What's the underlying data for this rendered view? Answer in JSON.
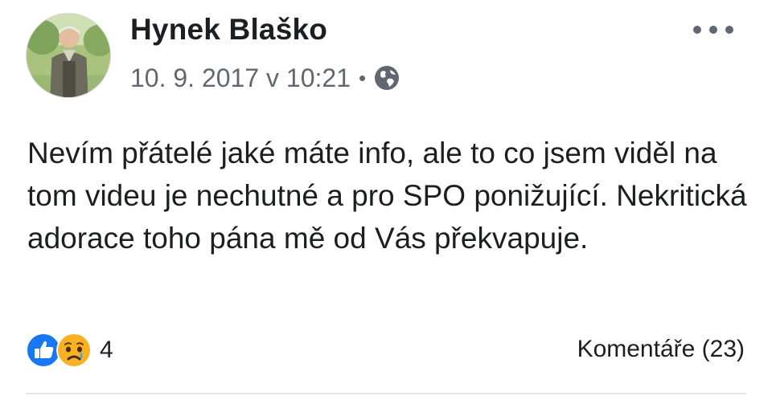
{
  "post": {
    "author": {
      "name": "Hynek Blaško",
      "avatar_icon": "person-photo"
    },
    "timestamp": "10. 9. 2017 v 10:21",
    "separator": "•",
    "audience_icon": "globe-icon",
    "more_icon": "more-options-icon",
    "text": "Nevím přátelé jaké máte info, ale to co jsem viděl na tom videu je nechutné a pro SPO ponižující. Nekritická adorace toho pána mě od Vás překvapuje.",
    "reactions": {
      "icons": [
        "like-icon",
        "sad-icon"
      ],
      "count": "4"
    },
    "comments_label": "Komentáře (23)"
  },
  "colors": {
    "like_blue": "#1877f2",
    "sad_yellow": "#f7b125",
    "meta_gray": "#606770",
    "text": "#1c1e21"
  }
}
